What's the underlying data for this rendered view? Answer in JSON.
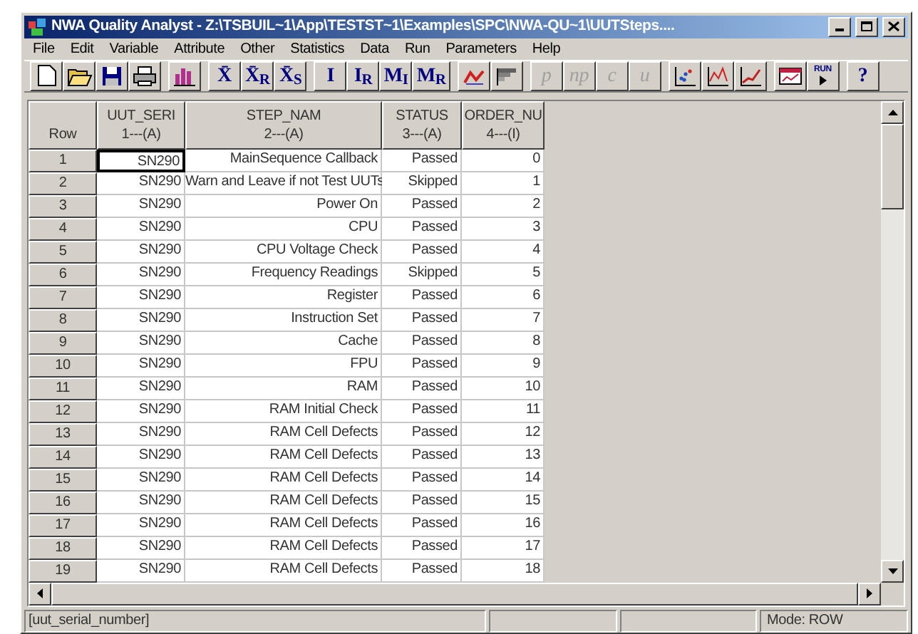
{
  "window": {
    "title": "NWA Quality Analyst - Z:\\TSBUIL~1\\App\\TESTST~1\\Examples\\SPC\\NWA-QU~1\\UUTSteps...."
  },
  "menu": [
    "File",
    "Edit",
    "Variable",
    "Attribute",
    "Other",
    "Statistics",
    "Data",
    "Run",
    "Parameters",
    "Help"
  ],
  "toolbar": [
    [
      {
        "kind": "icon"
      },
      {
        "kind": "icon"
      },
      {
        "kind": "icon"
      },
      {
        "kind": "icon"
      }
    ],
    [
      {
        "kind": "icon"
      }
    ],
    [
      {
        "kind": "text",
        "label": "X̄",
        "disabled": false
      },
      {
        "kind": "text",
        "label": "X̄$_{R}$",
        "disabled": false
      },
      {
        "kind": "text",
        "label": "X̄$_{S}$",
        "disabled": false
      }
    ],
    [
      {
        "kind": "text",
        "label": "I",
        "disabled": false
      },
      {
        "kind": "text",
        "label": "I$_{R}$",
        "disabled": false
      },
      {
        "kind": "text",
        "label": "M$_{I}$",
        "disabled": false
      },
      {
        "kind": "text",
        "label": "M$_{R}$",
        "disabled": false
      }
    ],
    [
      {
        "kind": "icon"
      },
      {
        "kind": "icon"
      }
    ],
    [
      {
        "kind": "text",
        "label": "p",
        "disabled": true
      },
      {
        "kind": "text",
        "label": "np",
        "disabled": true
      },
      {
        "kind": "text",
        "label": "c",
        "disabled": true
      },
      {
        "kind": "text",
        "label": "u",
        "disabled": true
      }
    ],
    [
      {
        "kind": "icon"
      },
      {
        "kind": "icon"
      },
      {
        "kind": "icon"
      }
    ],
    [
      {
        "kind": "icon"
      },
      {
        "kind": "run",
        "label": "RUN"
      }
    ],
    [
      {
        "kind": "text",
        "label": "?",
        "disabled": false
      }
    ]
  ],
  "table": {
    "corner": "Row",
    "columns": [
      {
        "name": "UUT_SERI",
        "code": "1---(A)"
      },
      {
        "name": "STEP_NAM",
        "code": "2---(A)"
      },
      {
        "name": "STATUS",
        "code": "3---(A)"
      },
      {
        "name": "ORDER_NU",
        "code": "4---(I)"
      }
    ],
    "rows": [
      {
        "row": "1",
        "cells": [
          "SN290",
          "MainSequence Callback",
          "Passed",
          "0"
        ],
        "selected": true
      },
      {
        "row": "2",
        "cells": [
          "SN290",
          "Warn and Leave if not Test UUTs",
          "Skipped",
          "1"
        ],
        "selected": false
      },
      {
        "row": "3",
        "cells": [
          "SN290",
          "Power On",
          "Passed",
          "2"
        ],
        "selected": false
      },
      {
        "row": "4",
        "cells": [
          "SN290",
          "CPU",
          "Passed",
          "3"
        ],
        "selected": false
      },
      {
        "row": "5",
        "cells": [
          "SN290",
          "CPU Voltage Check",
          "Passed",
          "4"
        ],
        "selected": false
      },
      {
        "row": "6",
        "cells": [
          "SN290",
          "Frequency Readings",
          "Skipped",
          "5"
        ],
        "selected": false
      },
      {
        "row": "7",
        "cells": [
          "SN290",
          "Register",
          "Passed",
          "6"
        ],
        "selected": false
      },
      {
        "row": "8",
        "cells": [
          "SN290",
          "Instruction Set",
          "Passed",
          "7"
        ],
        "selected": false
      },
      {
        "row": "9",
        "cells": [
          "SN290",
          "Cache",
          "Passed",
          "8"
        ],
        "selected": false
      },
      {
        "row": "10",
        "cells": [
          "SN290",
          "FPU",
          "Passed",
          "9"
        ],
        "selected": false
      },
      {
        "row": "11",
        "cells": [
          "SN290",
          "RAM",
          "Passed",
          "10"
        ],
        "selected": false
      },
      {
        "row": "12",
        "cells": [
          "SN290",
          "RAM Initial Check",
          "Passed",
          "11"
        ],
        "selected": false
      },
      {
        "row": "13",
        "cells": [
          "SN290",
          "RAM Cell Defects",
          "Passed",
          "12"
        ],
        "selected": false
      },
      {
        "row": "14",
        "cells": [
          "SN290",
          "RAM Cell Defects",
          "Passed",
          "13"
        ],
        "selected": false
      },
      {
        "row": "15",
        "cells": [
          "SN290",
          "RAM Cell Defects",
          "Passed",
          "14"
        ],
        "selected": false
      },
      {
        "row": "16",
        "cells": [
          "SN290",
          "RAM Cell Defects",
          "Passed",
          "15"
        ],
        "selected": false
      },
      {
        "row": "17",
        "cells": [
          "SN290",
          "RAM Cell Defects",
          "Passed",
          "16"
        ],
        "selected": false
      },
      {
        "row": "18",
        "cells": [
          "SN290",
          "RAM Cell Defects",
          "Passed",
          "17"
        ],
        "selected": false
      },
      {
        "row": "19",
        "cells": [
          "SN290",
          "RAM Cell Defects",
          "Passed",
          "18"
        ],
        "selected": false
      }
    ]
  },
  "status_bar": {
    "field": "[uut_serial_number]",
    "mode": "Mode: ROW"
  }
}
